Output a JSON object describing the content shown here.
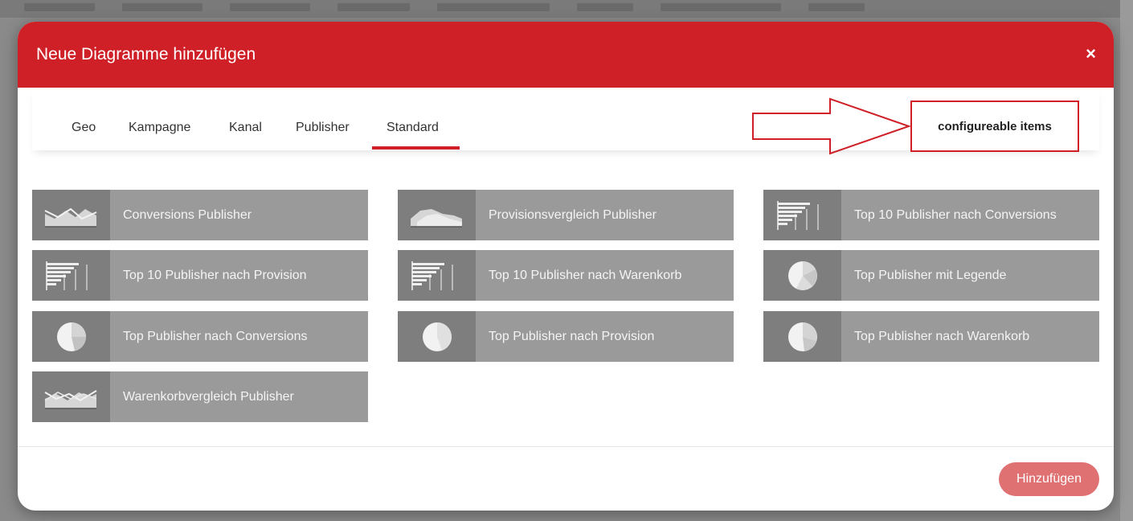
{
  "modal": {
    "title": "Neue Diagramme hinzufügen",
    "close_symbol": "×",
    "add_button_label": "Hinzufügen"
  },
  "tabs": [
    {
      "label": "Geo",
      "active": false
    },
    {
      "label": "Kampagne",
      "active": false
    },
    {
      "label": "Kanal",
      "active": false
    },
    {
      "label": "Publisher",
      "active": false
    },
    {
      "label": "Standard",
      "active": true
    }
  ],
  "annotation": {
    "label": "configureable items",
    "color": "#d02027"
  },
  "items": [
    {
      "label": "Conversions Publisher",
      "icon": "area-chart-icon"
    },
    {
      "label": "Provisionsvergleich Publisher",
      "icon": "area-chart-icon"
    },
    {
      "label": "Top 10 Publisher nach Conversions",
      "icon": "bar-chart-icon"
    },
    {
      "label": "Top 10 Publisher nach Provision",
      "icon": "bar-chart-icon"
    },
    {
      "label": "Top 10 Publisher nach Warenkorb",
      "icon": "bar-chart-icon"
    },
    {
      "label": "Top Publisher mit Legende",
      "icon": "pie-chart-icon"
    },
    {
      "label": "Top Publisher nach Conversions",
      "icon": "pie-chart-icon"
    },
    {
      "label": "Top Publisher nach Provision",
      "icon": "pie-chart-icon"
    },
    {
      "label": "Top Publisher nach Warenkorb",
      "icon": "pie-chart-icon"
    },
    {
      "label": "Warenkorbvergleich Publisher",
      "icon": "area-chart-icon"
    }
  ],
  "colors": {
    "brand_red": "#d02027",
    "card_bg": "#9a9a9a",
    "card_thumb_bg": "#7e7e7e",
    "add_button_bg": "#e07173"
  }
}
